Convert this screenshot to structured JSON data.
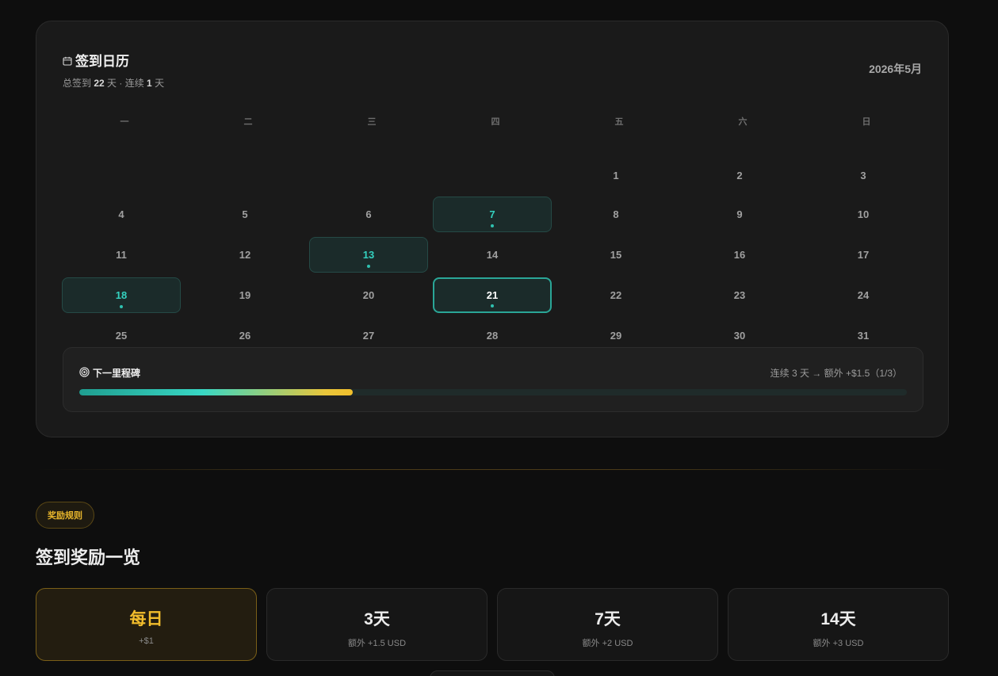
{
  "calendar": {
    "title": "签到日历",
    "subtitle_prefix": "总签到 ",
    "total_days": "22",
    "subtitle_mid": " 天 · 连续 ",
    "streak_days": "1",
    "subtitle_suffix": " 天",
    "month": "2026年5月",
    "weekdays": [
      "一",
      "二",
      "三",
      "四",
      "五",
      "六",
      "日"
    ],
    "weeks": [
      [
        null,
        null,
        null,
        null,
        {
          "day": "1"
        },
        {
          "day": "2"
        },
        {
          "day": "3"
        }
      ],
      [
        {
          "day": "4"
        },
        {
          "day": "5"
        },
        {
          "day": "6"
        },
        {
          "day": "7",
          "signed": true
        },
        {
          "day": "8"
        },
        {
          "day": "9"
        },
        {
          "day": "10"
        }
      ],
      [
        {
          "day": "11"
        },
        {
          "day": "12"
        },
        {
          "day": "13",
          "signed": true
        },
        {
          "day": "14"
        },
        {
          "day": "15"
        },
        {
          "day": "16"
        },
        {
          "day": "17"
        }
      ],
      [
        {
          "day": "18",
          "signed": true
        },
        {
          "day": "19"
        },
        {
          "day": "20"
        },
        {
          "day": "21",
          "signed": true,
          "today": true
        },
        {
          "day": "22"
        },
        {
          "day": "23"
        },
        {
          "day": "24"
        }
      ],
      [
        {
          "day": "25"
        },
        {
          "day": "26"
        },
        {
          "day": "27"
        },
        {
          "day": "28"
        },
        {
          "day": "29"
        },
        {
          "day": "30"
        },
        {
          "day": "31"
        }
      ]
    ]
  },
  "milestone": {
    "title": "下一里程碑",
    "info": "连续 3 天 → 额外 +$1.5（1/3）",
    "progress": 0.33
  },
  "rules": {
    "badge": "奖励规则",
    "title": "签到奖励一览",
    "cards": [
      {
        "title": "每日",
        "sub": "+$1",
        "active": true
      },
      {
        "title": "3天",
        "sub": "额外 +1.5 USD"
      },
      {
        "title": "7天",
        "sub": "额外 +2 USD"
      },
      {
        "title": "14天",
        "sub": "额外 +3 USD"
      }
    ]
  },
  "colors": {
    "accent_teal": "#34d1bf",
    "accent_gold": "#f2bd2c",
    "background": "#0e0e0e"
  },
  "icons": {
    "calendar": "calendar-icon",
    "milestone": "target-icon"
  }
}
